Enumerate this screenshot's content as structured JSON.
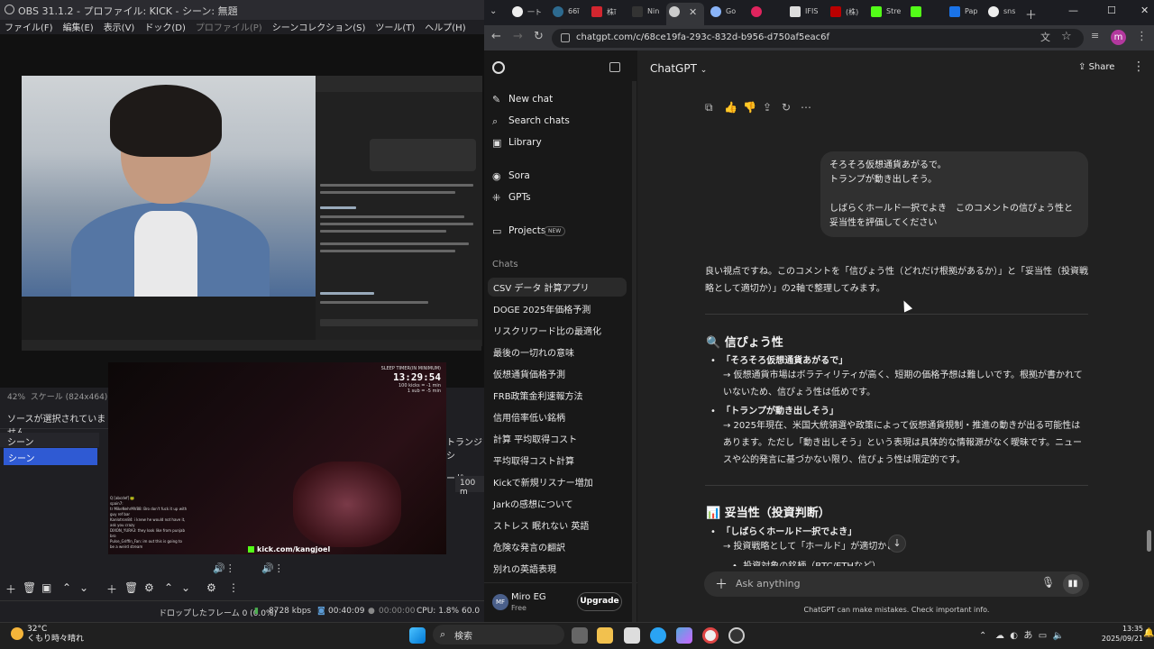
{
  "obs": {
    "title": "OBS 31.1.2 - プロファイル: KICK - シーン: 無題",
    "menu": [
      "ファイル(F)",
      "編集(E)",
      "表示(V)",
      "ドック(D)",
      "プロファイル(P)",
      "シーンコレクション(S)",
      "ツール(T)",
      "ヘルプ(H)"
    ],
    "zoom": "42%",
    "scale_label": "スケール (824x464)",
    "no_source": "ソースが選択されていません",
    "scenes_header": "シーン",
    "scene_item": "シーン",
    "transition_label": "トランジシ",
    "mode_label": "ード",
    "duration": "100 m",
    "status": {
      "dropped": "ドロップしたフレーム 0 (0.0%)",
      "bitrate": "8728 kbps",
      "time": "00:40:09",
      "rec_time": "00:00:00",
      "cpu": "CPU: 1.8%",
      "fps": "60.0"
    }
  },
  "stream": {
    "sleep_label": "SLEEP TIMER(IN MINIMUM)",
    "timer": "13:29:54",
    "sub1": "100 kicks = -1 min",
    "sub2": "1 sub = -5 min",
    "channel": "kick.com/kangjoel",
    "chat": [
      "Q [abcdef] 🐸",
      "spain7:",
      "tr MikeNehrMV88: Bro don't fuck it up with",
      "guy ref bar",
      "Kanlotron84: i knew he would not have it,",
      "ask you crazy",
      "DIXON_YURA3: they look like from punjab",
      "bro",
      "Pulse_Griffin_Fan: im out this is going to",
      "be a weird stream"
    ]
  },
  "browser": {
    "tabs": [
      "一ト",
      "66ĩ",
      "株ĩ",
      "Nin",
      "",
      "Go",
      "",
      "IFIS",
      "(株)",
      "Stre",
      "",
      "Pap",
      "sns"
    ],
    "url": "chatgpt.com/c/68ce19fa-293c-832d-b956-d750af5eac6f",
    "avatar": "m"
  },
  "sidebar": {
    "new_chat": "New chat",
    "search": "Search chats",
    "library": "Library",
    "sora": "Sora",
    "gpts": "GPTs",
    "projects": "Projects",
    "new_badge": "NEW",
    "chats_header": "Chats",
    "chats": [
      "CSV データ 計算アプリ",
      "DOGE 2025年価格予測",
      "リスクリワード比の最適化",
      "最後の一切れの意味",
      "仮想通貨価格予測",
      "FRB政策金利速報方法",
      "信用倍率低い銘柄",
      "計算 平均取得コスト",
      "平均取得コスト計算",
      "Kickで新規リスナー増加",
      "Jarkの感想について",
      "ストレス 眠れない 英語",
      "危険な発言の翻訳",
      "別れの英語表現"
    ],
    "user_initials": "MF",
    "user_name": "Miro EG",
    "plan": "Free",
    "upgrade": "Upgrade"
  },
  "main": {
    "title": "ChatGPT",
    "share": "Share",
    "user_msg": [
      "そろそろ仮想通貨あがるで。",
      "トランプが動き出しそう。",
      "",
      "しばらくホールド一択でよき　このコメントの信ぴょう性と妥当性を評価してください"
    ],
    "intro": "良い視点ですね。このコメントを「信ぴょう性（どれだけ根拠があるか）」と「妥当性（投資戦略として適切か）」の2軸で整理してみます。",
    "sec1_title": "信ぴょう性",
    "b1_title": "「そろそろ仮想通貨あがるで」",
    "b1_text": "→ 仮想通貨市場はボラティリティが高く、短期の価格予想は難しいです。根拠が書かれていないため、信ぴょう性は低めです。",
    "b2_title": "「トランプが動き出しそう」",
    "b2_text": "→ 2025年現在、米国大統領選や政策によって仮想通貨規制・推進の動きが出る可能性はあります。ただし「動き出しそう」という表現は具体的な情報源がなく曖昧です。ニュースや公的発言に基づかない限り、信ぴょう性は限定的です。",
    "sec2_title": "妥当性（投資判断）",
    "b3_title": "「しばらくホールド一択でよき」",
    "b3_text": "→ 投資戦略として「ホールド」が適切かどうか",
    "b4_text": "投資対象の銘柄（BTC/ETHなど）",
    "composer_placeholder": "Ask anything",
    "disclaimer": "ChatGPT can make mistakes. Check important info."
  },
  "taskbar": {
    "temp": "32°C",
    "weather": "くもり時々晴れ",
    "search": "検索",
    "ime": "あ",
    "time": "13:35",
    "date": "2025/09/21"
  }
}
